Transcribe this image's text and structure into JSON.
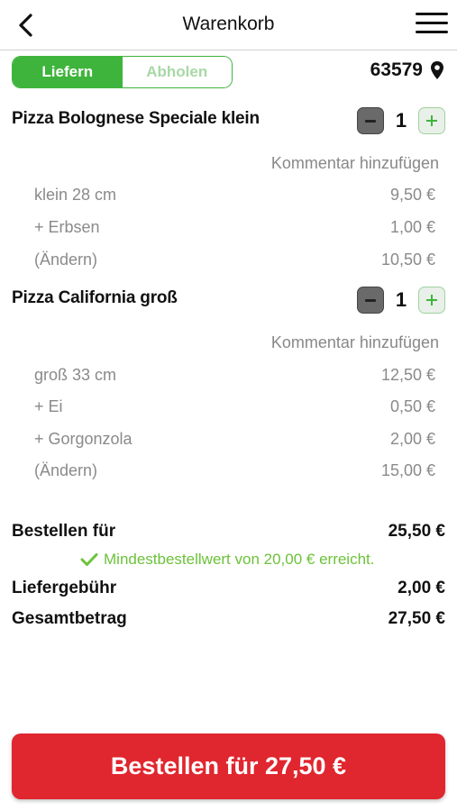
{
  "header": {
    "title": "Warenkorb",
    "back_icon": "chevron-left-icon",
    "menu_icon": "hamburger-icon"
  },
  "delivery_toggle": {
    "options": [
      "Liefern",
      "Abholen"
    ],
    "selected": "Liefern"
  },
  "location": {
    "zip": "63579",
    "icon": "map-pin-icon"
  },
  "cart": {
    "items": [
      {
        "name": "Pizza Bolognese Speciale klein",
        "quantity": "1",
        "comment_label": "Kommentar hinzufügen",
        "lines": [
          {
            "label": "klein 28 cm",
            "price": "9,50 €"
          },
          {
            "label": "+ Erbsen",
            "price": "1,00 €"
          },
          {
            "label": "(Ändern)",
            "price": "10,50 €"
          }
        ]
      },
      {
        "name": "Pizza California groß",
        "quantity": "1",
        "comment_label": "Kommentar hinzufügen",
        "lines": [
          {
            "label": "groß 33 cm",
            "price": "12,50 €"
          },
          {
            "label": "+ Ei",
            "price": "0,50 €"
          },
          {
            "label": "+ Gorgonzola",
            "price": "2,00 €"
          },
          {
            "label": "(Ändern)",
            "price": "15,00 €"
          }
        ]
      }
    ]
  },
  "summary": {
    "order_for_label": "Bestellen für",
    "order_for_value": "25,50 €",
    "minimum_note": "Mindestbestellwert von 20,00 € erreicht.",
    "delivery_fee_label": "Liefergebühr",
    "delivery_fee_value": "2,00 €",
    "total_label": "Gesamtbetrag",
    "total_value": "27,50 €"
  },
  "order_button": {
    "label": "Bestellen für 27,50 €"
  },
  "colors": {
    "accent_green": "#3fb43c",
    "success_green": "#6cc23a",
    "order_red": "#e0262e"
  }
}
